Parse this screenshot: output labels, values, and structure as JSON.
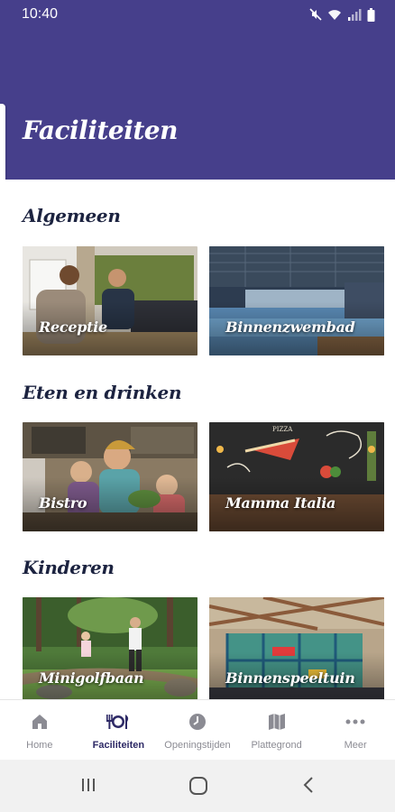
{
  "status": {
    "time": "10:40",
    "icons": [
      "mute-icon",
      "wifi-icon",
      "signal-icon",
      "battery-icon"
    ]
  },
  "header": {
    "title": "Faciliteiten",
    "background": "#463f8b"
  },
  "sections": [
    {
      "title": "Algemeen",
      "tiles": [
        {
          "label": "Receptie"
        },
        {
          "label": "Binnenzwembad"
        }
      ]
    },
    {
      "title": "Eten en drinken",
      "tiles": [
        {
          "label": "Bistro"
        },
        {
          "label": "Mamma Italia"
        }
      ]
    },
    {
      "title": "Kinderen",
      "tiles": [
        {
          "label": "Minigolfbaan"
        },
        {
          "label": "Binnenspeeltuin"
        }
      ]
    }
  ],
  "bottom_nav": {
    "items": [
      {
        "label": "Home",
        "icon": "home-icon",
        "active": false
      },
      {
        "label": "Faciliteiten",
        "icon": "cutlery-icon",
        "active": true
      },
      {
        "label": "Openingstijden",
        "icon": "clock-icon",
        "active": false
      },
      {
        "label": "Plattegrond",
        "icon": "map-icon",
        "active": false
      },
      {
        "label": "Meer",
        "icon": "more-icon",
        "active": false
      }
    ],
    "active_color": "#2e2a66",
    "inactive_color": "#8b8b93"
  },
  "system_nav": [
    "recent-apps-icon",
    "home-circle-icon",
    "back-icon"
  ]
}
